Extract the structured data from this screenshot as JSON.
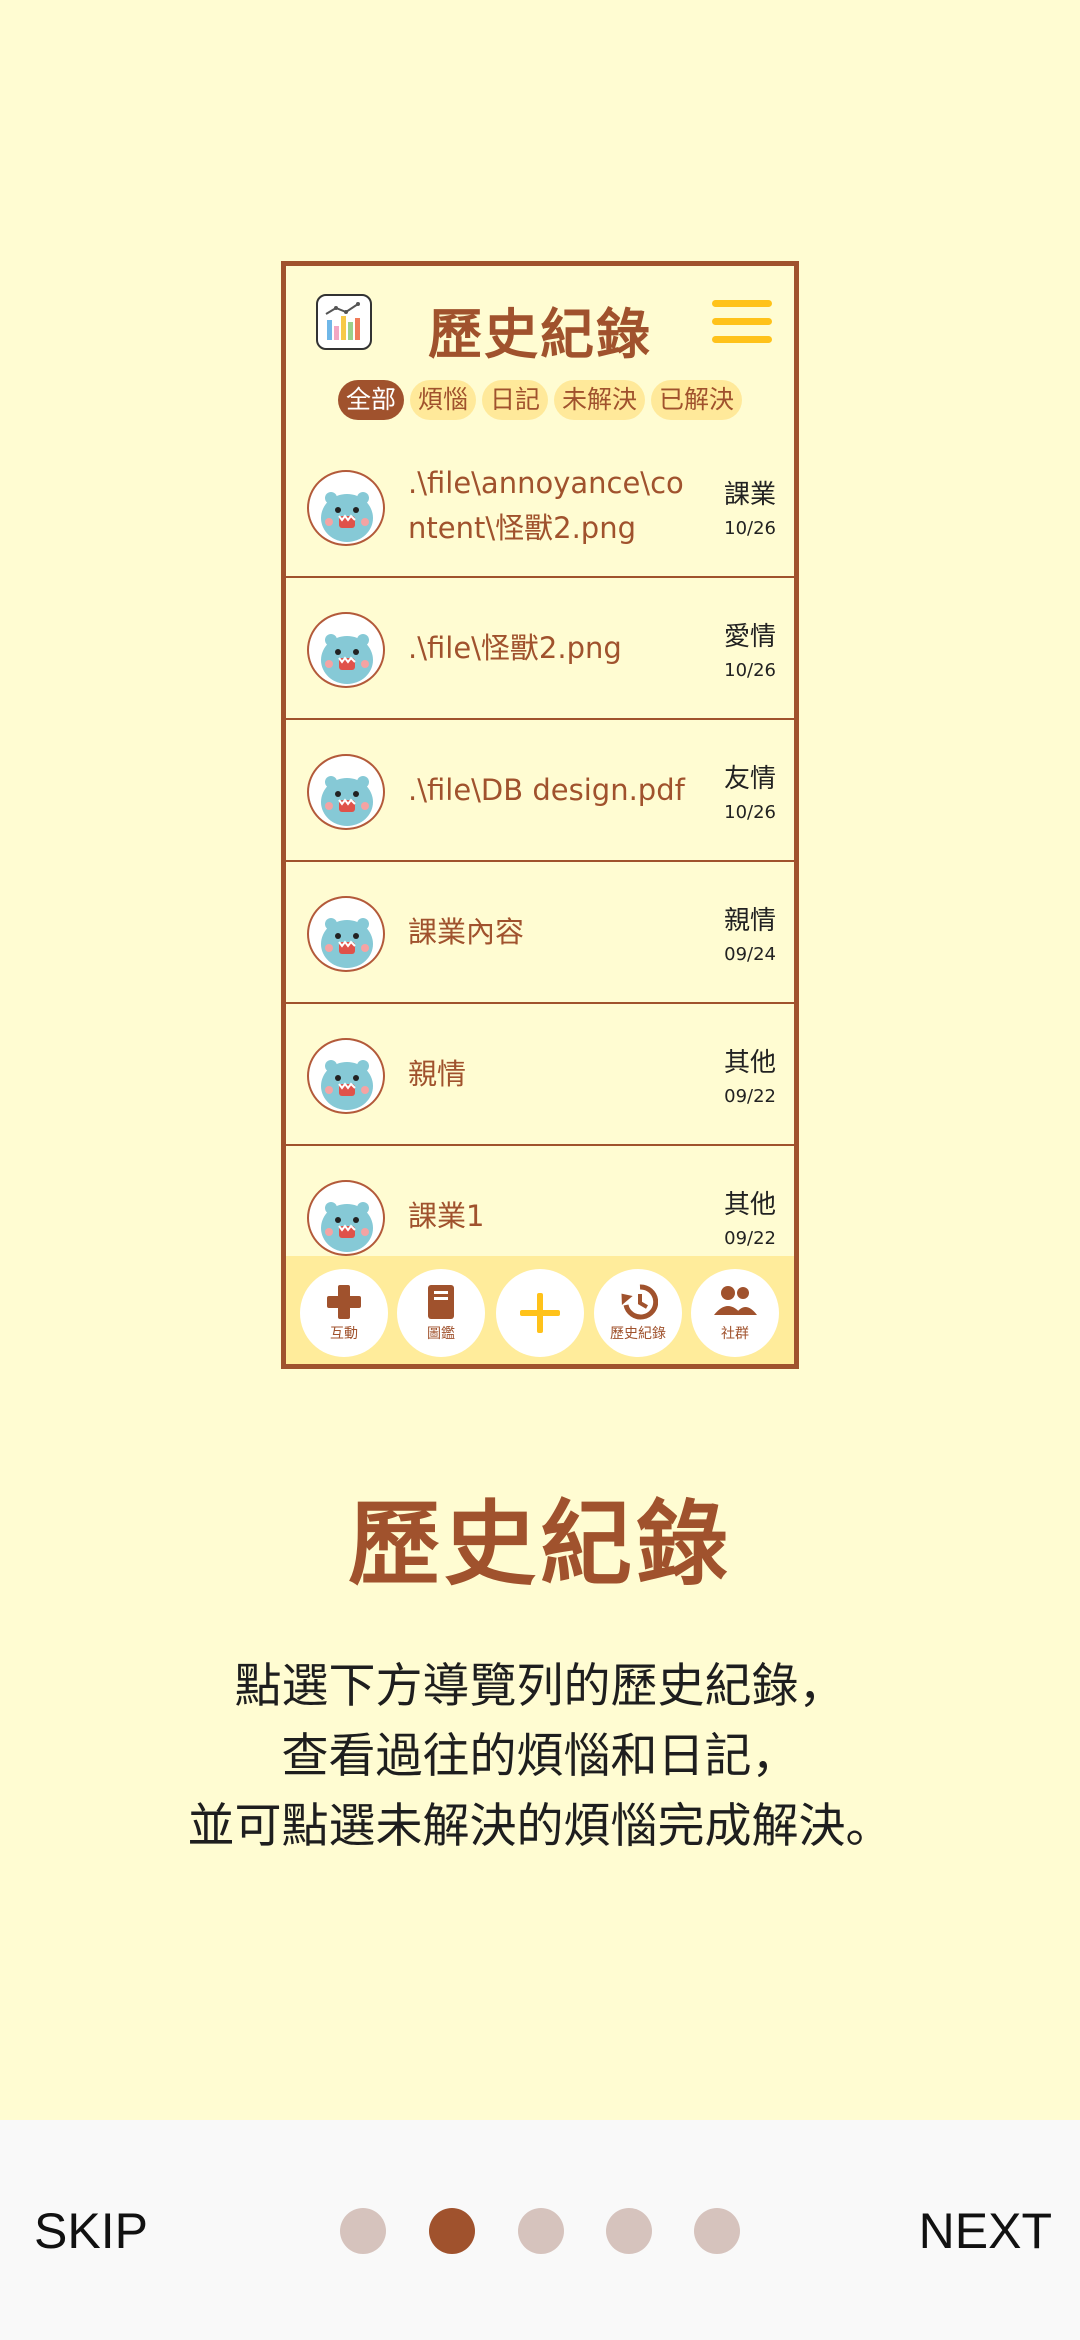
{
  "mockup": {
    "title": "歷史紀錄",
    "filters": [
      {
        "label": "全部",
        "active": true
      },
      {
        "label": "煩惱",
        "active": false
      },
      {
        "label": "日記",
        "active": false
      },
      {
        "label": "未解決",
        "active": false
      },
      {
        "label": "已解決",
        "active": false
      }
    ],
    "items": [
      {
        "text": ".\\file\\annoyance\\content\\怪獸2.png",
        "category": "課業",
        "date": "10/26"
      },
      {
        "text": ".\\file\\怪獸2.png",
        "category": "愛情",
        "date": "10/26"
      },
      {
        "text": ".\\file\\DB design.pdf",
        "category": "友情",
        "date": "10/26"
      },
      {
        "text": "課業內容",
        "category": "親情",
        "date": "09/24"
      },
      {
        "text": "親情",
        "category": "其他",
        "date": "09/22"
      },
      {
        "text": "課業1",
        "category": "其他",
        "date": "09/22"
      }
    ],
    "nav": [
      {
        "label": "互動",
        "icon": "gamepad-icon"
      },
      {
        "label": "圖鑑",
        "icon": "book-icon"
      },
      {
        "label": "",
        "icon": "plus-icon"
      },
      {
        "label": "歷史紀錄",
        "icon": "history-icon"
      },
      {
        "label": "社群",
        "icon": "group-icon"
      }
    ]
  },
  "onboarding": {
    "title": "歷史紀錄",
    "description_lines": [
      "點選下方導覽列的歷史紀錄，",
      "查看過往的煩惱和日記，",
      "並可點選未解決的煩惱完成解決。"
    ],
    "skip_label": "SKIP",
    "next_label": "NEXT",
    "page_count": 5,
    "current_page": 2
  },
  "colors": {
    "background": "#FFFCD2",
    "accent": "#A0522D",
    "yellow": "#FFC21A",
    "chip": "#FFE99A",
    "dot_inactive": "#D6C3BD"
  }
}
